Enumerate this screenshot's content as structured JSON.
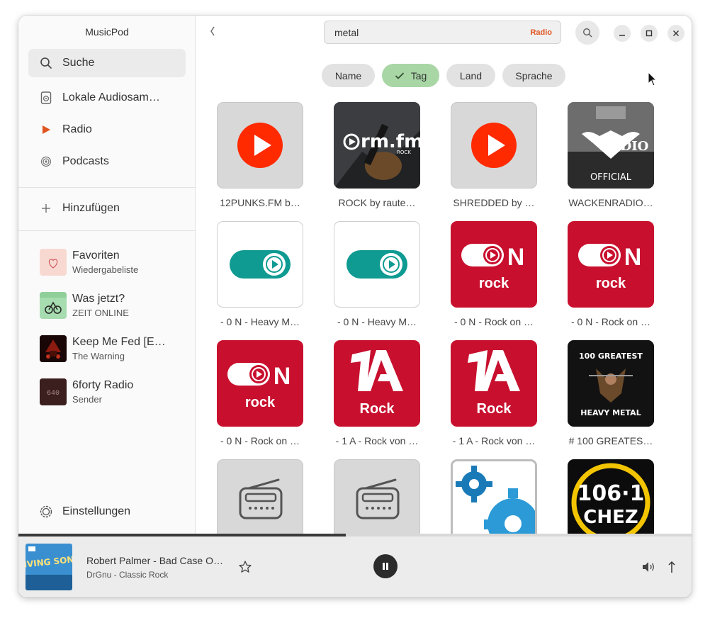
{
  "app": {
    "title": "MusicPod"
  },
  "sidebar": {
    "search_label": "Suche",
    "nav": [
      {
        "label": "Lokale Audiosam…",
        "icon": "local-audio-icon"
      },
      {
        "label": "Radio",
        "icon": "radio-play-icon"
      },
      {
        "label": "Podcasts",
        "icon": "podcast-icon"
      }
    ],
    "add_label": "Hinzufügen",
    "favorites": [
      {
        "title": "Favoriten",
        "subtitle": "Wiedergabeliste"
      },
      {
        "title": "Was jetzt?",
        "subtitle": "ZEIT ONLINE"
      },
      {
        "title": "Keep Me Fed [E…",
        "subtitle": "The Warning"
      },
      {
        "title": "6forty Radio",
        "subtitle": "Sender"
      }
    ],
    "settings_label": "Einstellungen"
  },
  "search": {
    "value": "metal",
    "mode": "Radio"
  },
  "filters": [
    {
      "label": "Name",
      "selected": false
    },
    {
      "label": "Tag",
      "selected": true
    },
    {
      "label": "Land",
      "selected": false
    },
    {
      "label": "Sprache",
      "selected": false
    }
  ],
  "stations": [
    {
      "caption": "12PUNKS.FM b…",
      "art": "play-circle"
    },
    {
      "caption": "ROCK by raute…",
      "art": "rm-fm-rock",
      "logo_text": "rm.fm",
      "logo_sub": "ROCK"
    },
    {
      "caption": "SHREDDED by …",
      "art": "play-circle"
    },
    {
      "caption": "WACKENRADIO…",
      "art": "wacken-radio",
      "logo_text": "RADIO",
      "logo_sub": "OFFICIAL"
    },
    {
      "caption": "- 0 N - Heavy M…",
      "art": "0n-teal"
    },
    {
      "caption": "- 0 N - Heavy M…",
      "art": "0n-teal"
    },
    {
      "caption": "- 0 N - Rock on …",
      "art": "0n-rock",
      "logo_sub": "rock"
    },
    {
      "caption": "- 0 N - Rock on …",
      "art": "0n-rock",
      "logo_sub": "rock"
    },
    {
      "caption": "- 0 N - Rock on …",
      "art": "0n-rock",
      "logo_sub": "rock"
    },
    {
      "caption": "- 1 A - Rock von …",
      "art": "1a-rock",
      "logo_sub": "Rock"
    },
    {
      "caption": "- 1 A - Rock von …",
      "art": "1a-rock",
      "logo_sub": "Rock"
    },
    {
      "caption": "# 100 GREATES…",
      "art": "100-greatest",
      "logo_text": "100 GREATEST",
      "logo_sub": "HEAVY METAL"
    },
    {
      "caption": "",
      "art": "radio-placeholder"
    },
    {
      "caption": "",
      "art": "radio-placeholder"
    },
    {
      "caption": "",
      "art": "gears"
    },
    {
      "caption": "",
      "art": "chez",
      "logo_text": "106·1",
      "logo_sub": "CHEZ"
    }
  ],
  "player": {
    "title": "Robert Palmer - Bad Case O…",
    "subtitle": "DrGnu - Classic Rock",
    "cover_text": "DRIVING SONGS",
    "progress": 0.486
  },
  "colors": {
    "accent": "#e0541f",
    "youtube_red": "#ff0000",
    "on_red": "#c8102e",
    "teal": "#0f9a92",
    "chip_selected": "#a8d6a5"
  }
}
